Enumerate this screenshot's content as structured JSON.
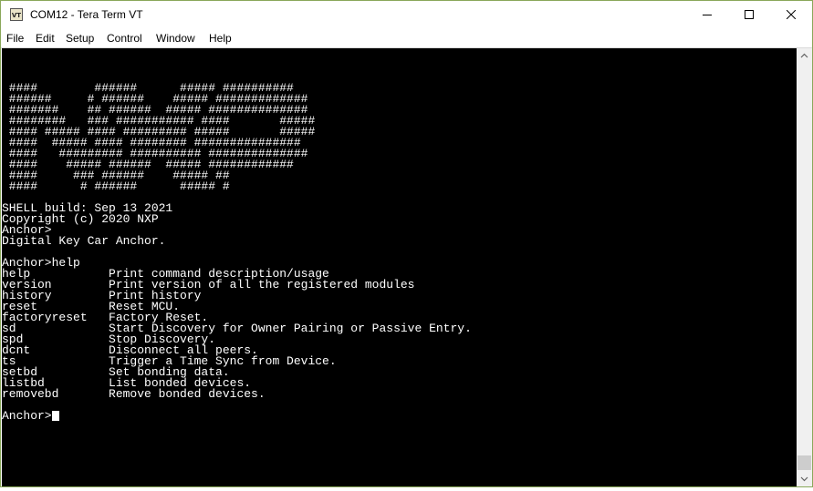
{
  "window": {
    "title": "COM12 - Tera Term VT",
    "icon_label": "VT"
  },
  "menu": {
    "items": [
      "File",
      "Edit",
      "Setup",
      "Control",
      "Window",
      "Help"
    ]
  },
  "terminal": {
    "lines": [
      " ####        ######      ##### ##########",
      " ######     # ######    ##### #############",
      " #######    ## ######  ##### ##############",
      " ########   ### ########### ####       #####",
      " #### ##### #### ######### #####       #####",
      " ####  ##### #### ######## ###############",
      " ####   ######### ########## ##############",
      " ####    ##### ######  ##### ############",
      " ####     ### ######    ##### ##",
      " ####      # ######      ##### #",
      "",
      "SHELL build: Sep 13 2021",
      "Copyright (c) 2020 NXP",
      "Anchor>",
      "Digital Key Car Anchor.",
      "",
      "Anchor>help",
      "help           Print command description/usage",
      "version        Print version of all the registered modules",
      "history        Print history",
      "reset          Reset MCU.",
      "factoryreset   Factory Reset.",
      "sd             Start Discovery for Owner Pairing or Passive Entry.",
      "spd            Stop Discovery.",
      "dcnt           Disconnect all peers.",
      "ts             Trigger a Time Sync from Device.",
      "setbd          Set bonding data.",
      "listbd         List bonded devices.",
      "removebd       Remove bonded devices.",
      "",
      "Anchor>"
    ],
    "colors": {
      "background": "#000000",
      "foreground": "#ffffff"
    }
  }
}
